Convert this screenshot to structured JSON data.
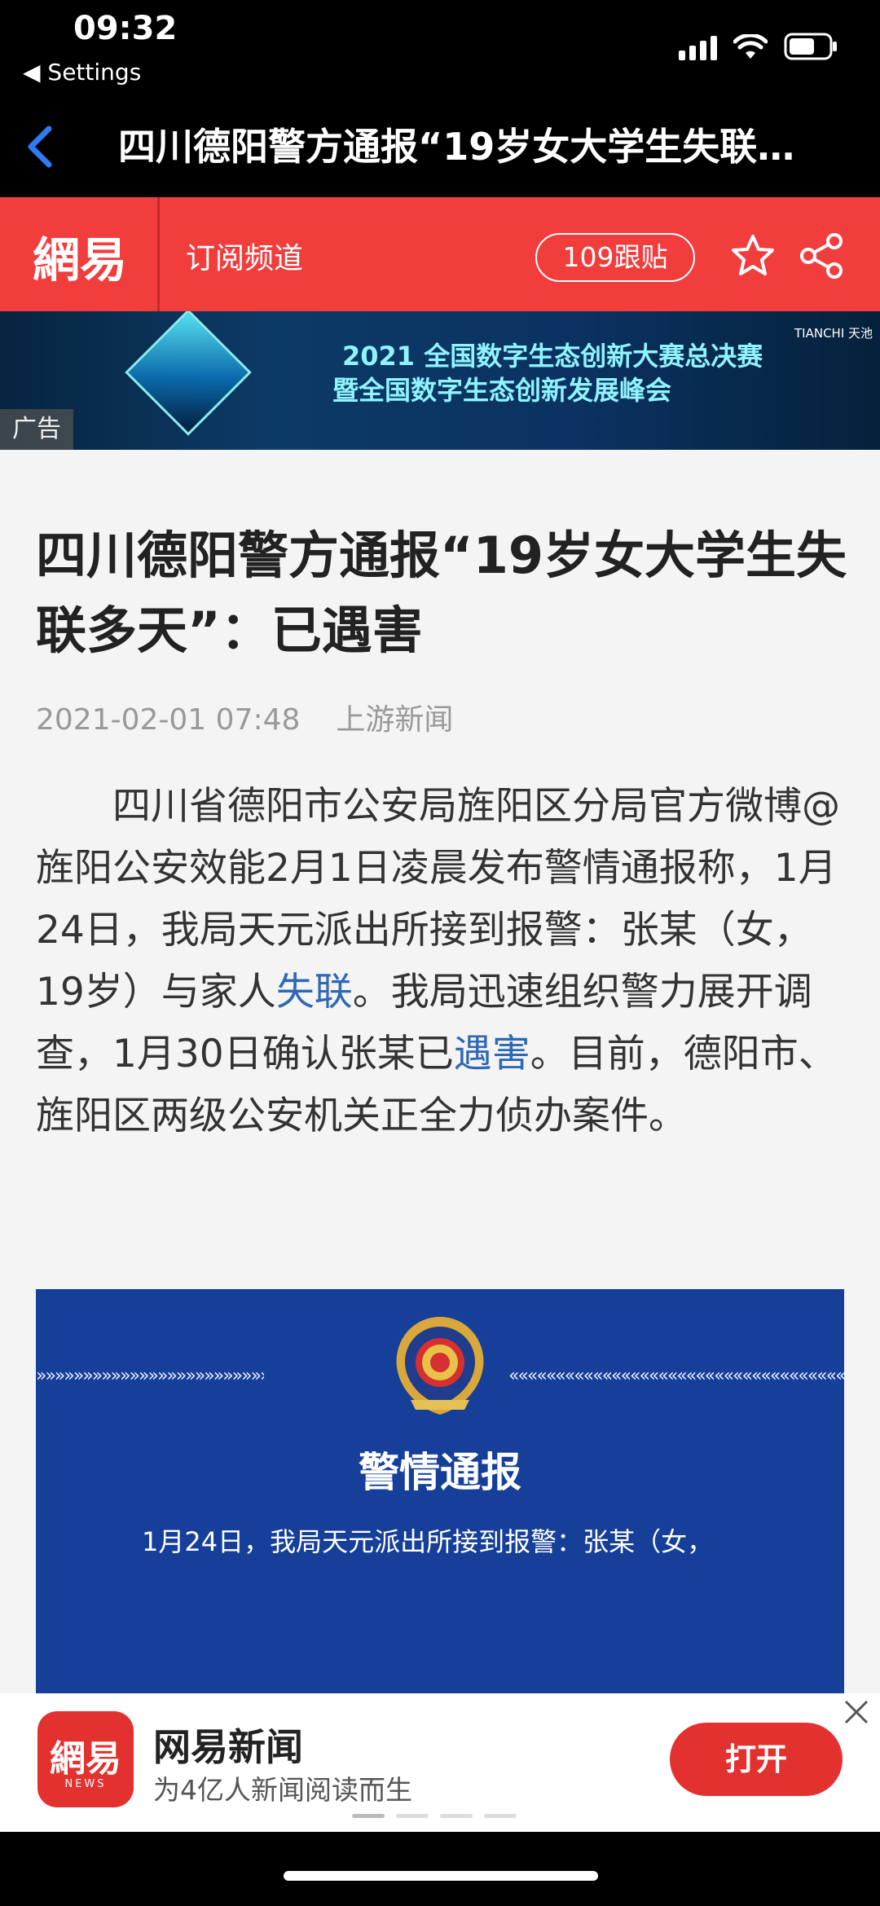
{
  "status_bar": {
    "time": "09:32",
    "back_app": "◀ Settings"
  },
  "nav": {
    "title": "四川德阳警方通报“19岁女大学生失联…"
  },
  "header": {
    "logo": "網易",
    "channel": "订阅频道",
    "comments": "109跟贴",
    "accent_color": "#f23d3d"
  },
  "ad": {
    "tag": "广告",
    "line1": "2021 全国数字生态创新大赛总决赛",
    "line2": "暨全国数字生态创新发展峰会",
    "brand": "TIANCHI 天池"
  },
  "article": {
    "headline": "四川德阳警方通报“19岁女大学生失联多天”：已遇害",
    "date": "2021-02-01 07:48",
    "source": "上游新闻",
    "body_part1": "四川省德阳市公安局旌阳区分局官方微博@旌阳公安效能2月1日凌晨发布警情通报称，1月24日，我局天元派出所接到报警：张某（女，19岁）与家人",
    "link1": "失联",
    "body_part2": "。我局迅速组织警力展开调查，1月30日确认张某已",
    "link2": "遇害",
    "body_part3": "。目前，德阳市、旌阳区两级公安机关正全力侦办案件。",
    "link_color": "#2f68b4"
  },
  "notice_image": {
    "title": "警情通报",
    "text": "1月24日，我局天元派出所接到报警：张某（女，"
  },
  "promo": {
    "icon_glyph": "網易",
    "icon_sub": "NEWS",
    "app_name": "网易新闻",
    "slogan": "为4亿人新闻阅读而生",
    "open_label": "打开"
  }
}
